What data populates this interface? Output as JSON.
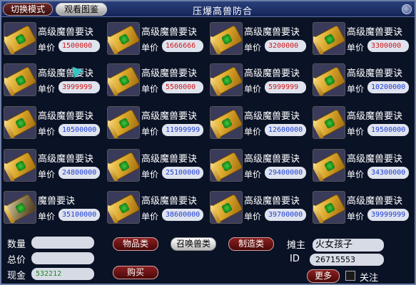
{
  "window": {
    "title": "压爆高兽防合",
    "mode_button": "切换模式",
    "view_button": "观看图鉴"
  },
  "items": [
    {
      "name": "高级魔兽要诀",
      "price_label": "单价",
      "price": "1500000",
      "price_color": "red"
    },
    {
      "name": "高级魔兽要诀",
      "price_label": "单价",
      "price": "1666666",
      "price_color": "red"
    },
    {
      "name": "高级魔兽要诀",
      "price_label": "单价",
      "price": "3200000",
      "price_color": "red"
    },
    {
      "name": "高级魔兽要诀",
      "price_label": "单价",
      "price": "3300000",
      "price_color": "red"
    },
    {
      "name": "高级魔兽要诀",
      "price_label": "单价",
      "price": "3999999",
      "price_color": "red"
    },
    {
      "name": "高级魔兽要诀",
      "price_label": "单价",
      "price": "5500000",
      "price_color": "red"
    },
    {
      "name": "高级魔兽要诀",
      "price_label": "单价",
      "price": "5999999",
      "price_color": "red"
    },
    {
      "name": "高级魔兽要诀",
      "price_label": "单价",
      "price": "10200000",
      "price_color": "blue"
    },
    {
      "name": "高级魔兽要诀",
      "price_label": "单价",
      "price": "10500000",
      "price_color": "blue"
    },
    {
      "name": "高级魔兽要诀",
      "price_label": "单价",
      "price": "11999999",
      "price_color": "blue"
    },
    {
      "name": "高级魔兽要诀",
      "price_label": "单价",
      "price": "12600000",
      "price_color": "blue"
    },
    {
      "name": "高级魔兽要诀",
      "price_label": "单价",
      "price": "19500000",
      "price_color": "blue"
    },
    {
      "name": "高级魔兽要诀",
      "price_label": "单价",
      "price": "24800000",
      "price_color": "blue"
    },
    {
      "name": "高级魔兽要诀",
      "price_label": "单价",
      "price": "25100000",
      "price_color": "blue"
    },
    {
      "name": "高级魔兽要诀",
      "price_label": "单价",
      "price": "29400000",
      "price_color": "blue"
    },
    {
      "name": "高级魔兽要诀",
      "price_label": "单价",
      "price": "34300000",
      "price_color": "blue"
    },
    {
      "name": "魔兽要诀",
      "price_label": "单价",
      "price": "35100000",
      "price_color": "blue"
    },
    {
      "name": "高级魔兽要诀",
      "price_label": "单价",
      "price": "38600000",
      "price_color": "blue"
    },
    {
      "name": "高级魔兽要诀",
      "price_label": "单价",
      "price": "39700000",
      "price_color": "blue"
    },
    {
      "name": "高级魔兽要诀",
      "price_label": "单价",
      "price": "39999999",
      "price_color": "blue"
    }
  ],
  "bottom": {
    "quantity_label": "数量",
    "quantity_value": "",
    "total_label": "总价",
    "total_value": "",
    "cash_label": "现金",
    "cash_value": "532212",
    "tab_items": "物品类",
    "tab_summon": "召唤兽类",
    "tab_craft": "制造类",
    "buy_button": "购买",
    "owner_label": "摊主",
    "owner_value": "火女孩子",
    "id_label": "ID",
    "id_value": "26715553",
    "more_button": "更多",
    "follow_label": "关注"
  },
  "colors": {
    "price_red": "#d01818",
    "price_blue": "#1d3fd6",
    "cash_green": "#1a8a1a"
  }
}
